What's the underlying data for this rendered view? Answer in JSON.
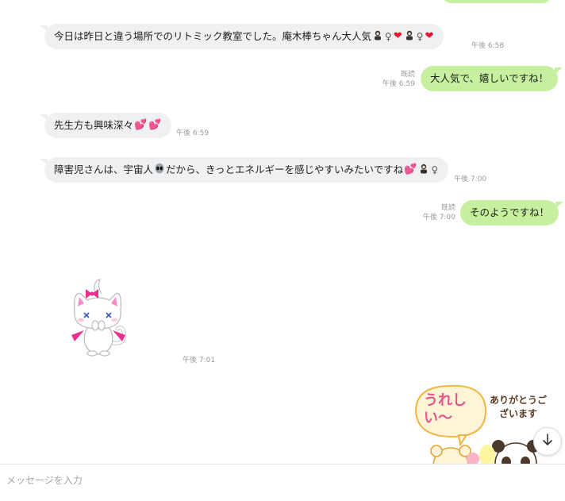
{
  "messages": [
    {
      "text": "今日は昨日と違う場所でのリトミック教室でした。庵木棒ちゃん大人気",
      "time": "午後 6:58"
    },
    {
      "text": "大人気で、嬉しいですね！",
      "read": "既読",
      "time": "午後 6:59"
    },
    {
      "text": "先生方も興味深々",
      "time": "午後 6:59"
    },
    {
      "text_before": "障害児さんは、宇宙人",
      "text_after": "だから、きっとエネルギーを感じやすいみたいですね",
      "time": "午後 7:00"
    },
    {
      "text": "そのようですね！",
      "read": "既読",
      "time": "午後 7:00"
    }
  ],
  "sticker_cat": {
    "time": "午後 7:01"
  },
  "sticker_bears": {
    "text_main": "うれしい〜",
    "text_sub": "ありがとうございます"
  },
  "input": {
    "placeholder": "メッセージを入力"
  },
  "colors": {
    "outgoing": "#c6f0a0",
    "incoming": "#eff0f2",
    "heart": "#e8112d",
    "pink_heart": "#ee3f9a"
  },
  "icons": [
    "heart-icon",
    "pink-hearts-icon",
    "alien-icon",
    "female-sign-icon",
    "scroll-down-arrow-icon"
  ]
}
